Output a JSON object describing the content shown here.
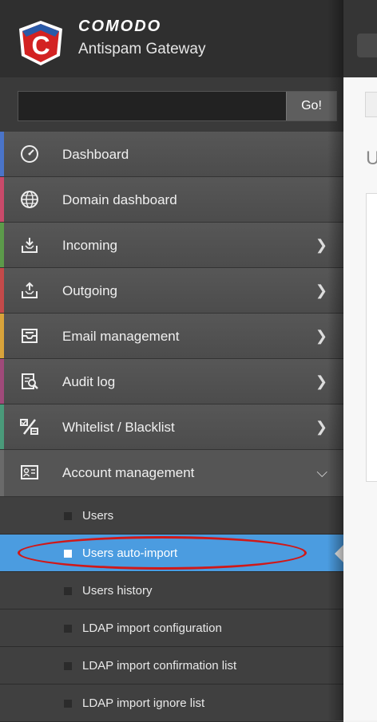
{
  "header": {
    "brand": "COMODO",
    "product": "Antispam Gateway"
  },
  "search": {
    "value": "",
    "go_label": "Go!"
  },
  "nav": {
    "items": [
      {
        "label": "Dashboard",
        "icon": "dashboard-gauge-icon",
        "accent": "#4a74c9",
        "has_children": false
      },
      {
        "label": "Domain dashboard",
        "icon": "globe-icon",
        "accent": "#c94a6a",
        "has_children": false
      },
      {
        "label": "Incoming",
        "icon": "inbox-download-icon",
        "accent": "#5c9a4a",
        "has_children": true
      },
      {
        "label": "Outgoing",
        "icon": "outbox-upload-icon",
        "accent": "#c44a4a",
        "has_children": true
      },
      {
        "label": "Email management",
        "icon": "email-tray-icon",
        "accent": "#d8a33a",
        "has_children": true
      },
      {
        "label": "Audit log",
        "icon": "audit-search-icon",
        "accent": "#a04a7a",
        "has_children": true
      },
      {
        "label": "Whitelist / Blacklist",
        "icon": "whitelist-percent-icon",
        "accent": "#4a9a7a",
        "has_children": true
      },
      {
        "label": "Account management",
        "icon": "account-card-icon",
        "accent": "#6a6a6a",
        "has_children": true,
        "open": true
      }
    ],
    "submenu": [
      {
        "label": "Users",
        "active": false
      },
      {
        "label": "Users auto-import",
        "active": true
      },
      {
        "label": "Users history",
        "active": false
      },
      {
        "label": "LDAP import configuration",
        "active": false
      },
      {
        "label": "LDAP import confirmation list",
        "active": false
      },
      {
        "label": "LDAP import ignore list",
        "active": false
      }
    ]
  },
  "colors": {
    "active_submenu": "#4b9ce0",
    "highlight_circle": "#d01818"
  }
}
